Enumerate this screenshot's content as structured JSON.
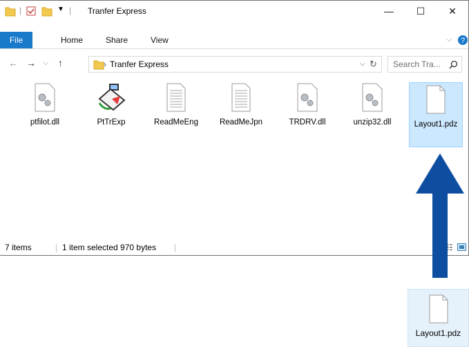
{
  "window": {
    "title": "Tranfer Express",
    "controls": {
      "minimize": "—",
      "maximize": "☐",
      "close": "✕"
    }
  },
  "ribbon": {
    "tabs": [
      "File",
      "Home",
      "Share",
      "View"
    ]
  },
  "address": {
    "path": "Tranfer Express",
    "search_placeholder": "Search Tra..."
  },
  "files": [
    {
      "name": "ptfilot.dll",
      "icon": "dll-gear-icon"
    },
    {
      "name": "PtTrExp",
      "icon": "app-transfer-icon"
    },
    {
      "name": "ReadMeEng",
      "icon": "text-document-icon"
    },
    {
      "name": "ReadMeJpn",
      "icon": "text-document-icon"
    },
    {
      "name": "TRDRV.dll",
      "icon": "dll-gear-icon"
    },
    {
      "name": "unzip32.dll",
      "icon": "dll-gear-icon"
    },
    {
      "name": "Layout1.pdz",
      "icon": "blank-document-icon",
      "selected": true
    }
  ],
  "status": {
    "items": "7 items",
    "selection": "1 item selected  970 bytes"
  },
  "dragged_file": {
    "name": "Layout1.pdz"
  },
  "colors": {
    "accent": "#1979ca",
    "arrow": "#0d4ea1",
    "selection": "#cce8ff"
  }
}
